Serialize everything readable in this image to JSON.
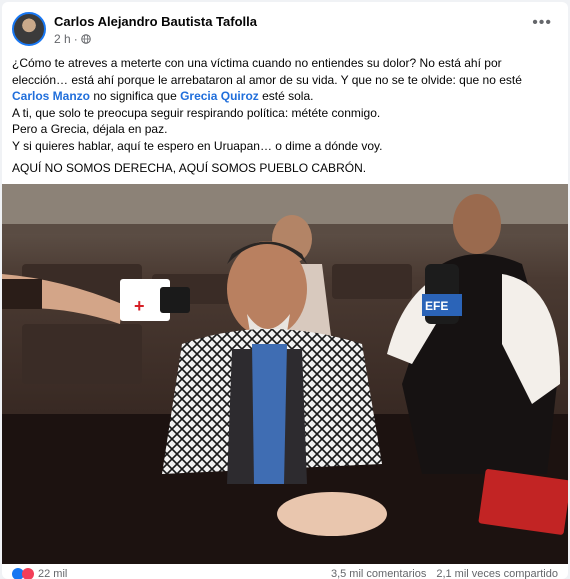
{
  "post": {
    "author": "Carlos Alejandro Bautista Tafolla",
    "time": "2 h",
    "separator": "·",
    "more_icon": "more-dots-icon",
    "privacy_icon": "globe-icon"
  },
  "body": {
    "line1_a": "¿Cómo te atreves a meterte con una víctima cuando no entiendes su dolor? No está ahí por elección… está ahí porque le arrebataron al amor de su vida. Y que no se te olvide: que no esté ",
    "mention1": "Carlos Manzo",
    "line1_b": " no significa que ",
    "mention2": "Grecia Quiroz",
    "line1_c": " esté sola.",
    "line2": "A ti, que solo te preocupa seguir respirando política: météte conmigo.",
    "line3": "Pero a Grecia, déjala en paz.",
    "line4": "Y si quieres hablar, aquí te espero en Uruapan… o dime a dónde voy.",
    "line5": "AQUÍ NO SOMOS DERECHA, AQUÍ SOMOS PUEBLO CABRÓN."
  },
  "photo": {
    "mic1_label": "+",
    "mic2_label": "EFE"
  },
  "footer": {
    "reactions": "22 mil",
    "comments": "3,5 mil comentarios",
    "shares": "2,1 mil veces compartido"
  },
  "colors": {
    "link": "#216fdb",
    "secondary_text": "#65676b",
    "like_blue": "#1877f2",
    "love_red": "#f33e58"
  }
}
